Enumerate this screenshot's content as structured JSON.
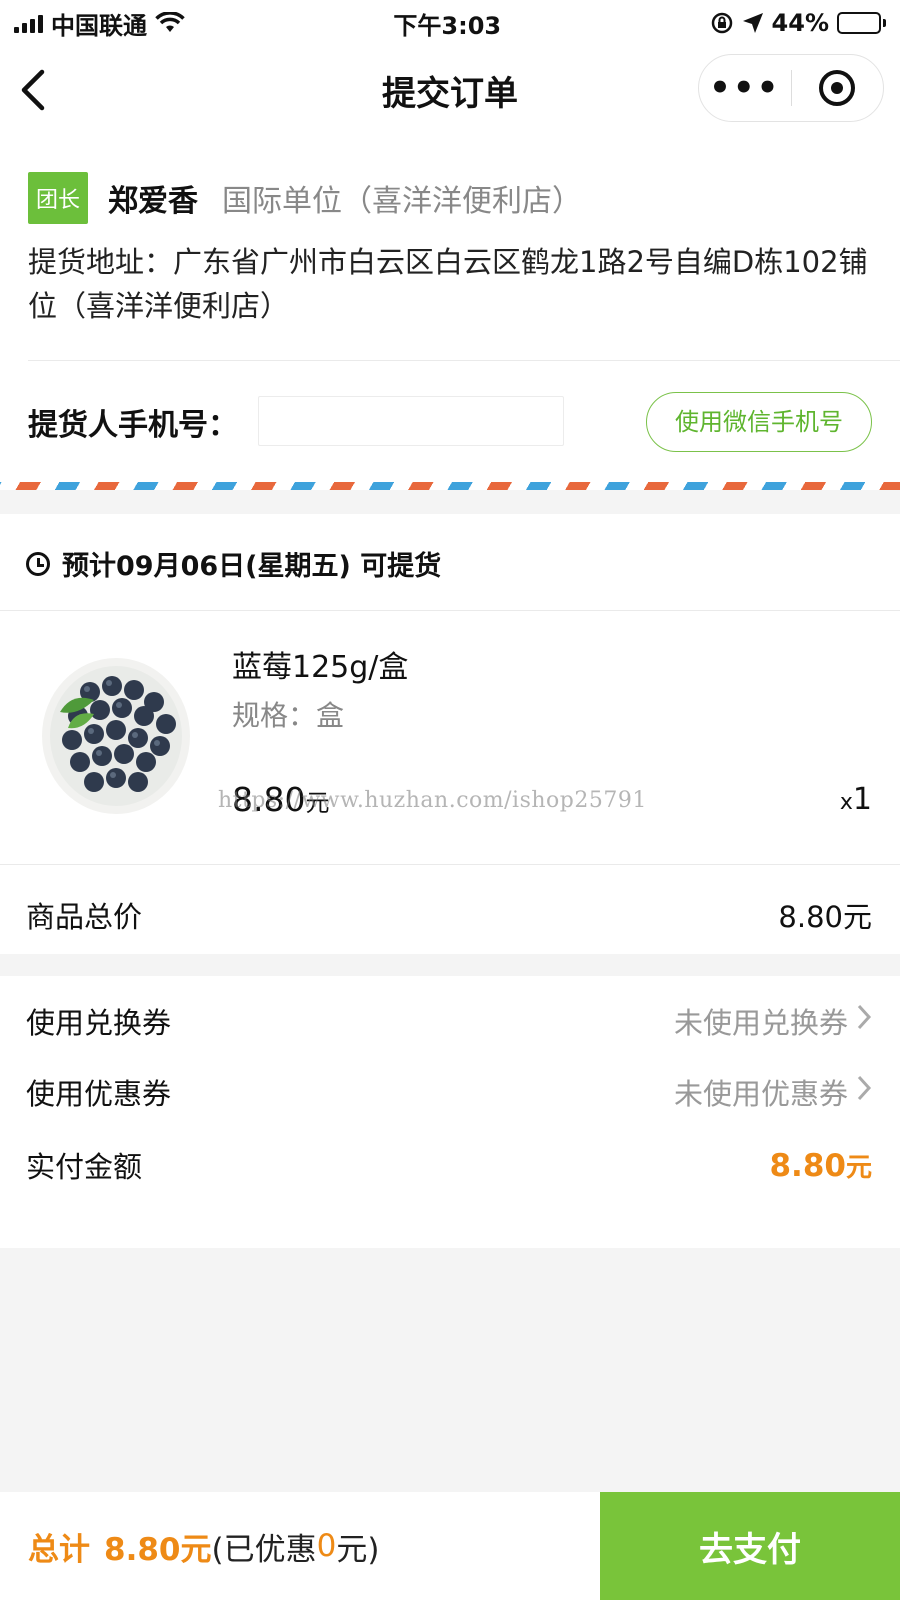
{
  "status_bar": {
    "carrier": "中国联通",
    "time": "下午3:03",
    "battery": "44%",
    "battery_level": 0.44
  },
  "nav": {
    "title": "提交订单",
    "more_label": "•••"
  },
  "pickup": {
    "leader_badge": "团长",
    "leader_name": "郑爱香",
    "leader_store": "国际单位（喜洋洋便利店）",
    "address": "提货地址：广东省广州市白云区白云区鹤龙1路2号自编D栋102铺位（喜洋洋便利店）",
    "phone_label": "提货人手机号：",
    "phone_value": "",
    "wechat_phone_button": "使用微信手机号"
  },
  "goods": {
    "eta": "预计09月06日(星期五) 可提货",
    "product": {
      "name": "蓝莓125g/盒",
      "spec": "规格：盒",
      "price": "8.80",
      "price_unit": "元",
      "qty_prefix": "x",
      "qty": "1"
    },
    "watermark": "https://www.huzhan.com/ishop25791",
    "subtotal_label": "商品总价",
    "subtotal_value": "8.80元"
  },
  "coupons": {
    "exchange_label": "使用兑换券",
    "exchange_value": "未使用兑换券",
    "discount_label": "使用优惠券",
    "discount_value": "未使用优惠券",
    "paid_label": "实付金额",
    "paid_value": "8.80",
    "paid_unit": "元"
  },
  "bottom": {
    "total_label": "总计",
    "total_amount": "8.80元",
    "discount_prefix": "(已优惠",
    "discount_amount": "0",
    "discount_suffix": "元)",
    "pay_button": "去支付"
  },
  "colors": {
    "accent_green": "#79c43a",
    "price_orange": "#ee8a16"
  }
}
